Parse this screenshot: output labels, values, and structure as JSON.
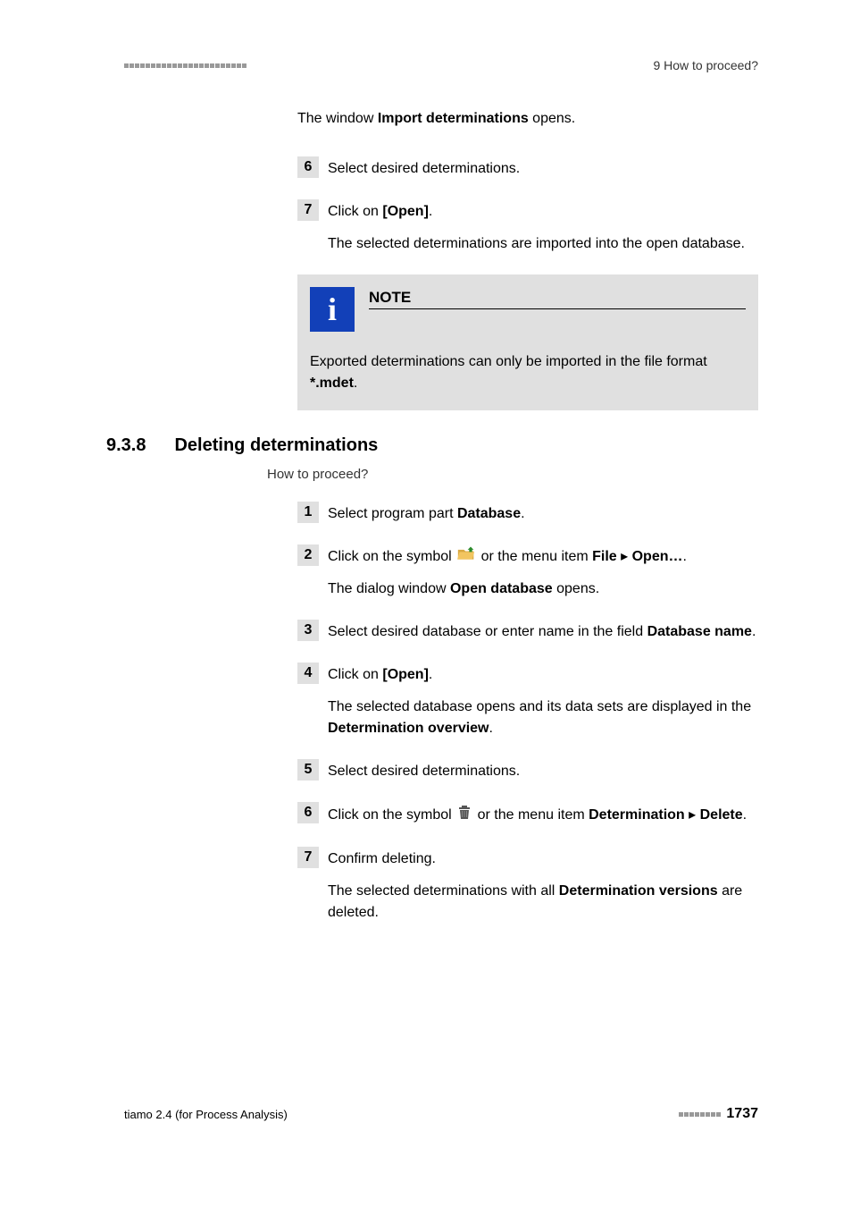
{
  "header": {
    "right_text": "9 How to proceed?"
  },
  "intro_line": {
    "pre": "The window ",
    "bold": "Import determinations",
    "post": " opens."
  },
  "steps_top": [
    {
      "num": "6",
      "text": "Select desired determinations."
    },
    {
      "num": "7",
      "pre": "Click on ",
      "bold": "[Open]",
      "post": ".",
      "follow": "The selected determinations are imported into the open database."
    }
  ],
  "note": {
    "title": "NOTE",
    "body_pre": "Exported determinations can only be imported in the file format ",
    "body_bold": "*.mdet",
    "body_post": "."
  },
  "section": {
    "num": "9.3.8",
    "title": "Deleting determinations",
    "subtitle": "How to proceed?"
  },
  "steps_bottom": [
    {
      "num": "1",
      "pre": "Select program part ",
      "bold": "Database",
      "post": "."
    },
    {
      "num": "2",
      "pre": "Click on the symbol ",
      "mid": " or the menu item ",
      "bold1": "File",
      "arrow": " ▸ ",
      "bold2": "Open…",
      "post": ".",
      "follow_pre": "The dialog window ",
      "follow_bold": "Open database",
      "follow_post": " opens.",
      "icon": "folder"
    },
    {
      "num": "3",
      "pre": "Select desired database or enter name in the field ",
      "bold": "Database name",
      "post": "."
    },
    {
      "num": "4",
      "pre": "Click on ",
      "bold": "[Open]",
      "post": ".",
      "follow_pre": "The selected database opens and its data sets are displayed in the ",
      "follow_bold": "Determination overview",
      "follow_post": "."
    },
    {
      "num": "5",
      "text": "Select desired determinations."
    },
    {
      "num": "6",
      "pre": "Click on the symbol ",
      "mid": " or the menu item ",
      "bold1": "Determination",
      "arrow": " ▸ ",
      "bold2": "Delete",
      "post": ".",
      "icon": "trash"
    },
    {
      "num": "7",
      "text": "Confirm deleting.",
      "follow_pre": "The selected determinations with all ",
      "follow_bold": "Determination versions",
      "follow_post": " are deleted."
    }
  ],
  "footer": {
    "left": "tiamo 2.4 (for Process Analysis)",
    "page": "1737"
  }
}
